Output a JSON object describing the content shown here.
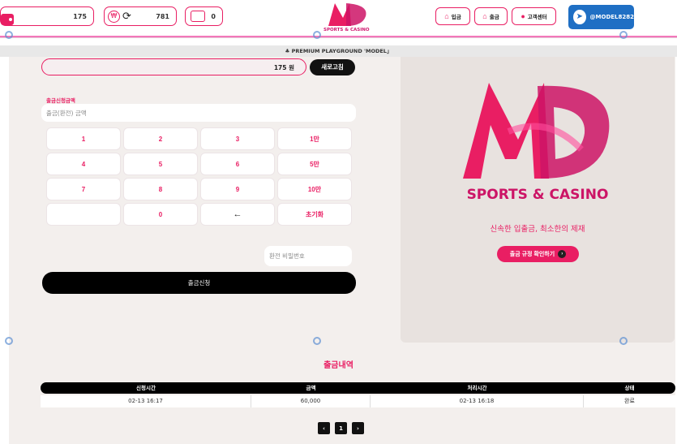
{
  "header": {
    "wallet_balance": "175",
    "point_balance": "781",
    "message_count": "0",
    "brand_logo_text": "SPORTS & CASINO",
    "deposit_label": "입금",
    "withdraw_label": "출금",
    "support_label": "고객센터",
    "telegram_label": "@MODEL8282"
  },
  "notice": {
    "text": "♣ PREMIUM PLAYGROUND 'MODEL」"
  },
  "withdraw": {
    "current_amount": "175 원",
    "refresh_label": "새로고침",
    "amount_label": "출금신청금액",
    "amount_placeholder": "출금(환전) 금액",
    "keys": [
      "1",
      "2",
      "3",
      "1만",
      "4",
      "5",
      "6",
      "5만",
      "7",
      "8",
      "9",
      "10만",
      "",
      "0",
      "←",
      "초기화"
    ],
    "password_placeholder": "환전 비밀번호",
    "submit_label": "출금신청"
  },
  "brand": {
    "name": "SPORTS & CASINO",
    "slogan": "신속한 입출금, 최소한의 제재",
    "rules_label": "출금 규정 확인하기"
  },
  "history": {
    "title": "출금내역",
    "columns": [
      "신청시간",
      "금액",
      "처리시간",
      "상태"
    ],
    "rows": [
      [
        "02-13 16:17",
        "60,000",
        "02-13 16:18",
        "완료"
      ]
    ]
  },
  "pager": {
    "prev": "‹",
    "current": "1",
    "next": "›"
  },
  "colors": {
    "accent": "#e91e63",
    "brand": "#cc1466",
    "telegram": "#1f6fc4"
  }
}
